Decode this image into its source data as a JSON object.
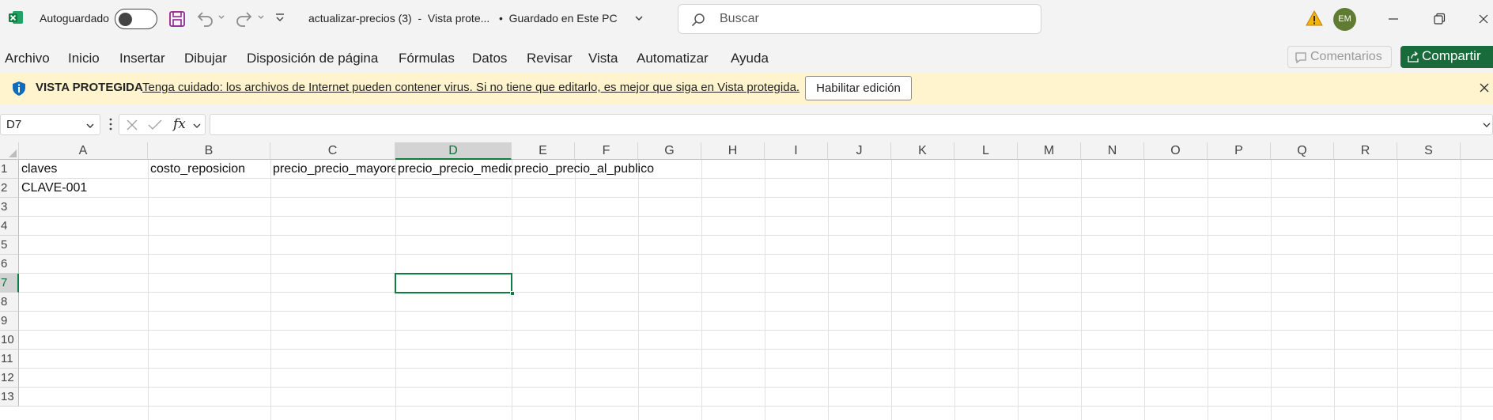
{
  "titlebar": {
    "autosave_label": "Autoguardado",
    "document_title": "actualizar-precios (3)  -  Vista prote...   •  Guardado en Este PC",
    "search_placeholder": "Buscar",
    "user_initials": "EM"
  },
  "menu": {
    "items": [
      "Archivo",
      "Inicio",
      "Insertar",
      "Dibujar",
      "Disposición de página",
      "Fórmulas",
      "Datos",
      "Revisar",
      "Vista",
      "Automatizar",
      "Ayuda"
    ],
    "comments_label": "Comentarios",
    "share_label": "Compartir"
  },
  "protected_view": {
    "title": "VISTA PROTEGIDA",
    "message": "Tenga cuidado: los archivos de Internet pueden contener virus. Si no tiene que editarlo, es mejor que siga en Vista protegida.",
    "button_label": "Habilitar edición"
  },
  "formula_bar": {
    "name_box": "D7",
    "fx_label": "fx",
    "formula": ""
  },
  "sheet": {
    "columns": [
      "A",
      "B",
      "C",
      "D",
      "E",
      "F",
      "G",
      "H",
      "I",
      "J",
      "K",
      "L",
      "M",
      "N",
      "O",
      "P",
      "Q",
      "R",
      "S"
    ],
    "rows": [
      "1",
      "2",
      "3",
      "4",
      "5",
      "6",
      "7",
      "8",
      "9",
      "10",
      "11",
      "12",
      "13"
    ],
    "active_cell": "D7",
    "cells": {
      "A1": "claves",
      "B1": "costo_reposicion",
      "C1": "precio_precio_mayoreo",
      "D1": "precio_precio_medio",
      "E1": "precio_precio_al_publico",
      "A2": "CLAVE-001"
    }
  },
  "colors": {
    "accent_green": "#107c41",
    "share_green": "#1a6b3c",
    "protected_bg": "#fff4ce",
    "avatar_green": "#5f7c32"
  }
}
